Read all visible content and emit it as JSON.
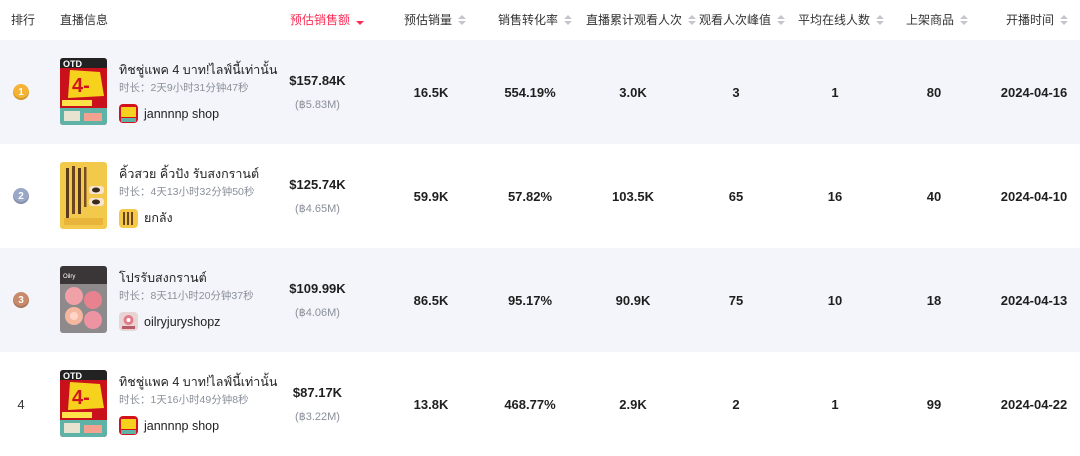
{
  "headers": {
    "rank": "排行",
    "live_info": "直播信息",
    "est_sales_amount": "预估销售额",
    "est_sales_volume": "预估销量",
    "conversion_rate": "销售转化率",
    "cumulative_viewers": "直播累计观看人次",
    "peak_viewers": "观看人次峰值",
    "avg_online": "平均在线人数",
    "products": "上架商品",
    "start_time": "开播时间"
  },
  "medal_colors": [
    "#f5b335",
    "#9aa7c7",
    "#c98a6b"
  ],
  "rows": [
    {
      "rank": "1",
      "title": "ทิชชู่แพค 4 บาท!ไลฟ์นี้เท่านั้น",
      "duration": "时长：2天9小时31分钟47秒",
      "shop": "jannnnp shop",
      "sales_usd": "$157.84K",
      "sales_thb": "(฿5.83M)",
      "volume": "16.5K",
      "conversion": "554.19%",
      "views": "3.0K",
      "peak": "3",
      "avg_online": "1",
      "products": "80",
      "start": "2024-04-16"
    },
    {
      "rank": "2",
      "title": "คิ้วสวย คิ้วปัง รับสงกรานต์",
      "duration": "时长：4天13小时32分钟50秒",
      "shop": "ยกลัง",
      "sales_usd": "$125.74K",
      "sales_thb": "(฿4.65M)",
      "volume": "59.9K",
      "conversion": "57.82%",
      "views": "103.5K",
      "peak": "65",
      "avg_online": "16",
      "products": "40",
      "start": "2024-04-10"
    },
    {
      "rank": "3",
      "title": "โปรรับสงกรานต์",
      "duration": "时长：8天11小时20分钟37秒",
      "shop": "oilryjuryshopz",
      "sales_usd": "$109.99K",
      "sales_thb": "(฿4.06M)",
      "volume": "86.5K",
      "conversion": "95.17%",
      "views": "90.9K",
      "peak": "75",
      "avg_online": "10",
      "products": "18",
      "start": "2024-04-13"
    },
    {
      "rank": "4",
      "title": "ทิชชู่แพค 4 บาท!ไลฟ์นี้เท่านั้น",
      "duration": "时长：1天16小时49分钟8秒",
      "shop": "jannnnp shop",
      "sales_usd": "$87.17K",
      "sales_thb": "(฿3.22M)",
      "volume": "13.8K",
      "conversion": "468.77%",
      "views": "2.9K",
      "peak": "2",
      "avg_online": "1",
      "products": "99",
      "start": "2024-04-22"
    }
  ]
}
